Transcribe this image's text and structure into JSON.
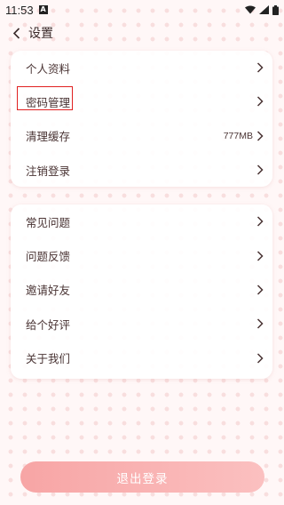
{
  "status_bar": {
    "time": "11:53",
    "notification_glyph": "A"
  },
  "header": {
    "title": "设置"
  },
  "section1": {
    "items": [
      {
        "label": "个人资料"
      },
      {
        "label": "密码管理"
      },
      {
        "label": "清理缓存",
        "value": "777MB"
      },
      {
        "label": "注销登录"
      }
    ]
  },
  "section2": {
    "items": [
      {
        "label": "常见问题"
      },
      {
        "label": "问题反馈"
      },
      {
        "label": "邀请好友"
      },
      {
        "label": "给个好评"
      },
      {
        "label": "关于我们"
      }
    ]
  },
  "logout": {
    "label": "退出登录"
  },
  "colors": {
    "accent": "#f7a5a5",
    "highlight_border": "#e02020",
    "dot_pattern": "#f8dede"
  }
}
